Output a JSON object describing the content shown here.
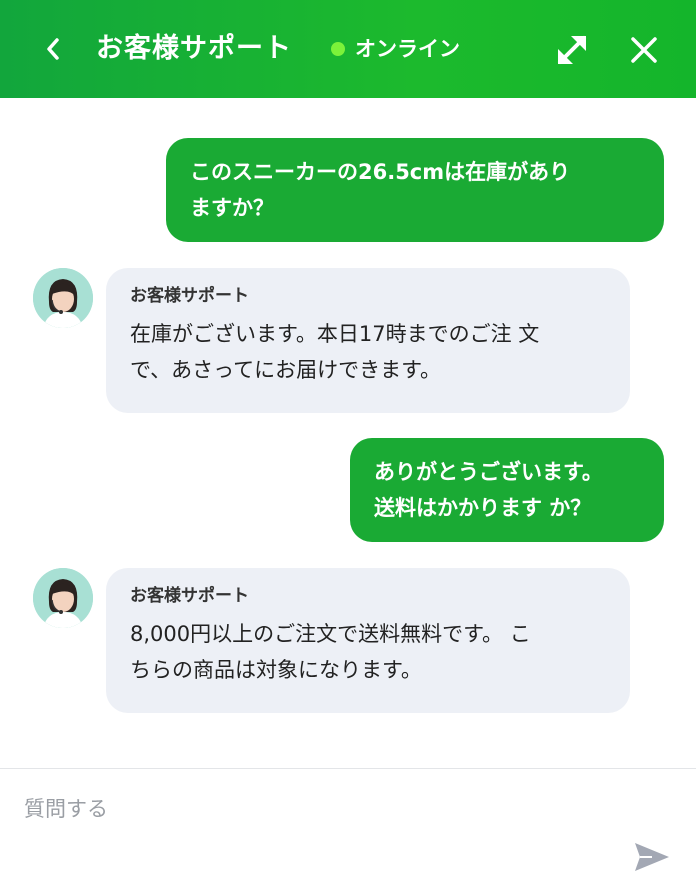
{
  "header": {
    "title": "お客様サポート",
    "status_label": "オンライン",
    "status_color": "#7cf23a",
    "brand_color": "#1aaa34",
    "back_icon": "chevron-left-icon",
    "expand_icon": "expand-icon",
    "close_icon": "close-icon"
  },
  "messages": [
    {
      "from": "user",
      "lines": [
        "このスニーカーの26.5cmは在庫があり",
        "ますか？"
      ]
    },
    {
      "from": "support",
      "sender": "お客様サポート",
      "lines": [
        "在庫がございます。本日17時までのご注 文",
        "で、あさってにお届けできます。"
      ]
    },
    {
      "from": "user",
      "lines": [
        "ありがとうございます。",
        "送料はかかります か？"
      ]
    },
    {
      "from": "support",
      "sender": "お客様サポート",
      "lines": [
        "8,000円以上のご注文で送料無料です。 こ",
        "ちらの商品は対象になります。"
      ]
    }
  ],
  "composer": {
    "placeholder": "質問する",
    "value": "",
    "send_icon": "send-icon"
  }
}
